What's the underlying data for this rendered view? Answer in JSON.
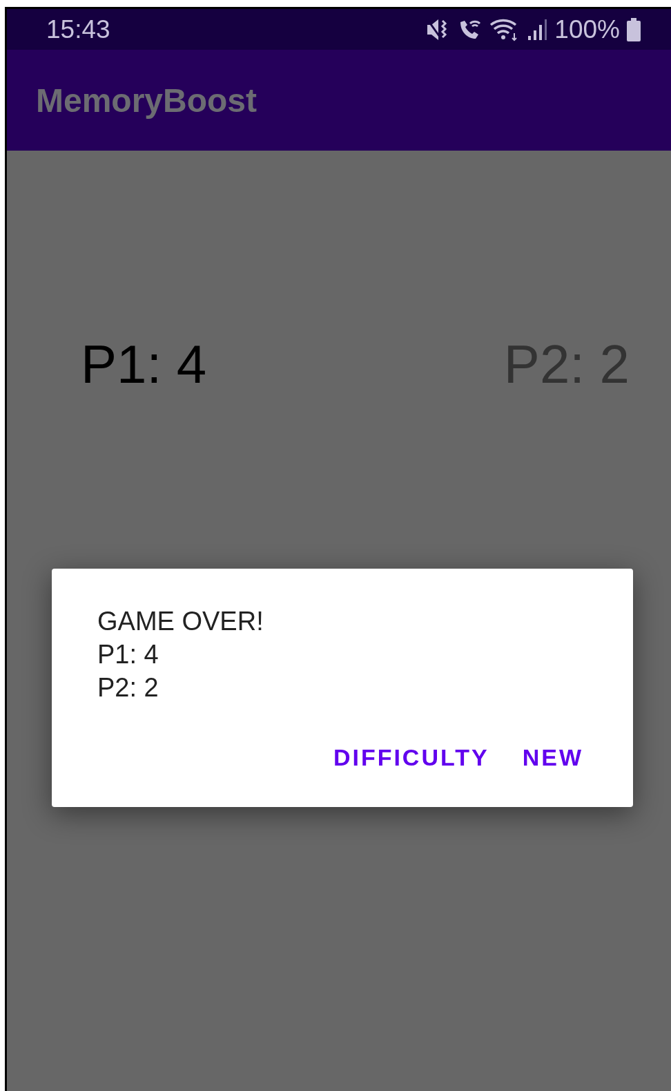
{
  "status_bar": {
    "time": "15:43",
    "battery": "100%"
  },
  "app_bar": {
    "title": "MemoryBoost"
  },
  "players": [
    {
      "label": "P1: 4",
      "active": true
    },
    {
      "label": "P2: 2",
      "active": false
    }
  ],
  "dialog": {
    "message": [
      "GAME OVER!",
      "P1: 4",
      "P2: 2"
    ],
    "buttons": [
      "DIFFICULTY",
      "NEW"
    ]
  }
}
